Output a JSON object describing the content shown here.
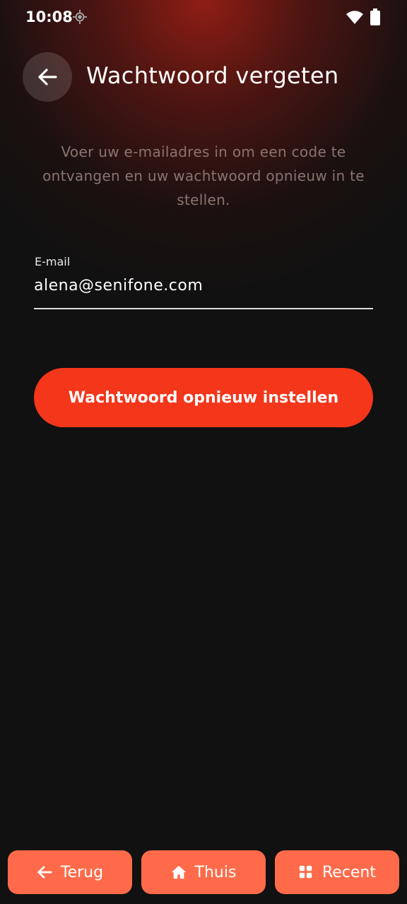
{
  "status_bar": {
    "time": "10:08",
    "icons": [
      "location-icon",
      "wifi-icon",
      "battery-icon"
    ]
  },
  "header": {
    "back_icon": "arrow-left-icon",
    "title": "Wachtwoord vergeten"
  },
  "form": {
    "description": "Voer uw e-mailadres in om een code te ontvangen en uw wachtwoord opnieuw in te stellen.",
    "email_label": "E-mail",
    "email_value": "alena@senifone.com",
    "submit_label": "Wachtwoord opnieuw instellen"
  },
  "bottom_nav": {
    "back_label": "Terug",
    "home_label": "Thuis",
    "recent_label": "Recent"
  },
  "colors": {
    "accent": "#f4361b",
    "nav_button": "#ff6b4a",
    "background": "#111111"
  }
}
